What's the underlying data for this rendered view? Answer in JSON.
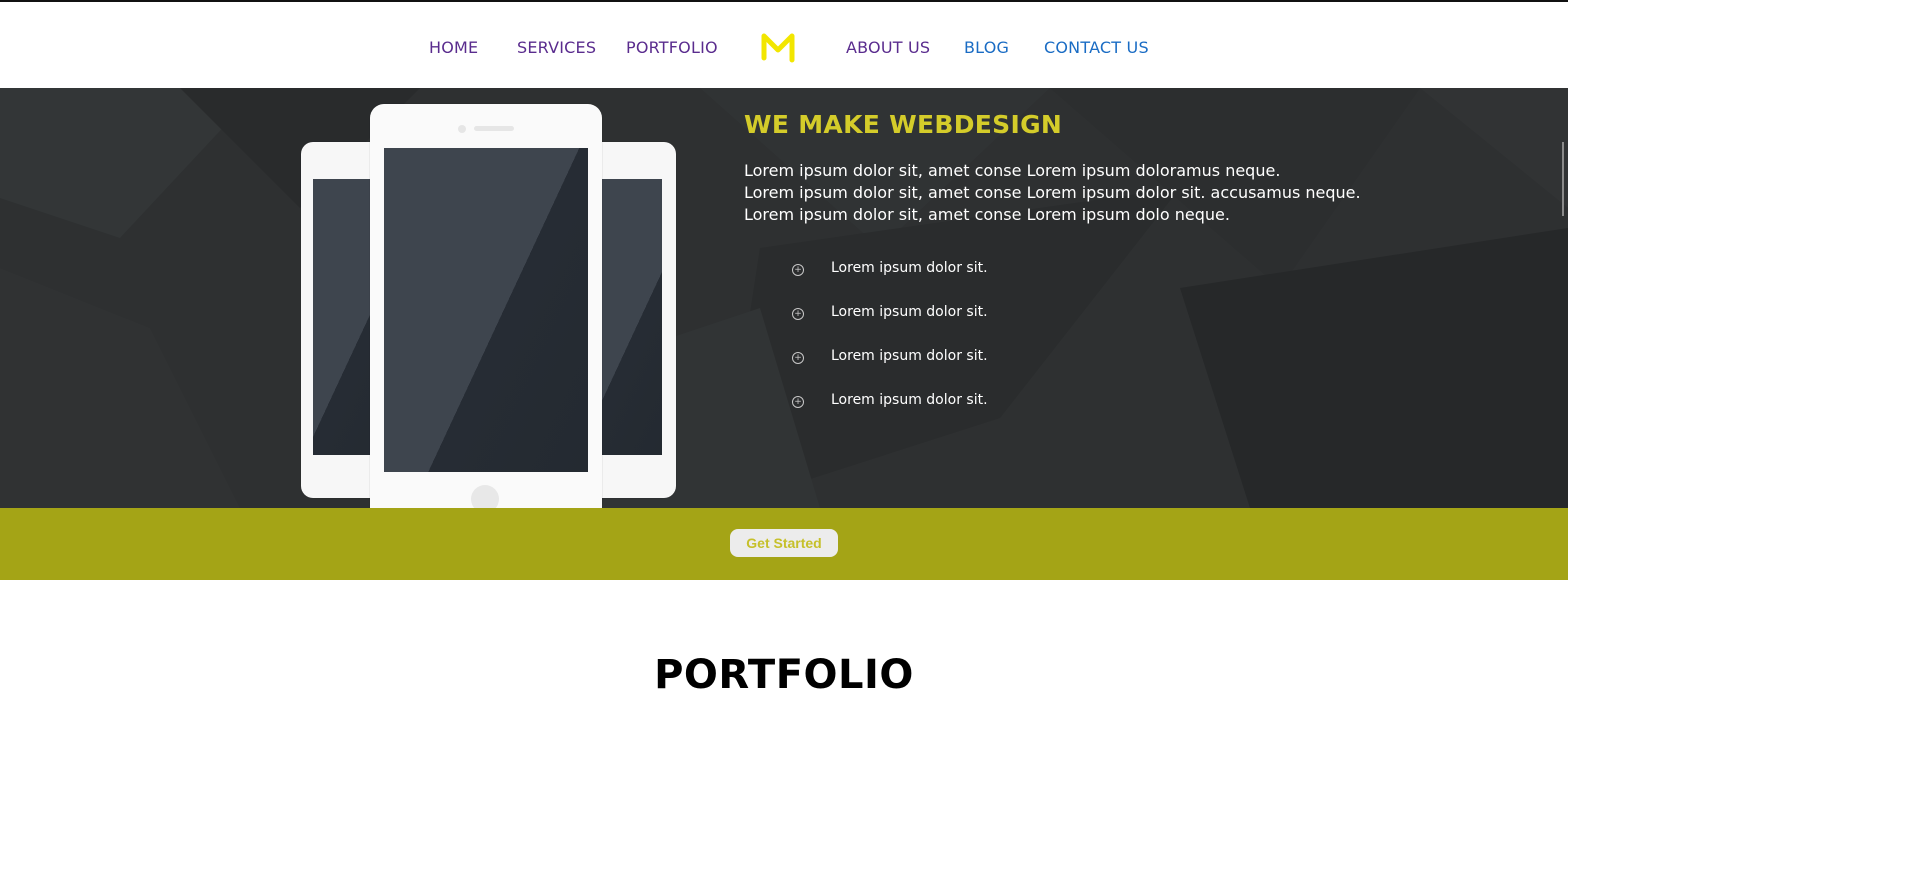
{
  "nav": {
    "items": [
      {
        "label": "HOME",
        "state": "visited"
      },
      {
        "label": "SERVICES",
        "state": "visited"
      },
      {
        "label": "PORTFOLIO",
        "state": "visited"
      },
      {
        "label": "ABOUT US",
        "state": "visited"
      },
      {
        "label": "BLOG",
        "state": "link"
      },
      {
        "label": "CONTACT US",
        "state": "link"
      }
    ],
    "logo_icon": "m-logo-icon",
    "logo_color": "#f2e600"
  },
  "hero": {
    "title": "WE MAKE WEBDESIGN",
    "paragraph_lines": [
      "Lorem ipsum dolor sit, amet conse Lorem ipsum doloramus neque.",
      "Lorem ipsum dolor sit, amet conse Lorem ipsum dolor sit. accusamus neque.",
      "Lorem ipsum dolor sit, amet conse Lorem ipsum dolo neque."
    ],
    "list_items": [
      "Lorem ipsum dolor sit.",
      "Lorem ipsum dolor sit.",
      "Lorem ipsum dolor sit.",
      "Lorem ipsum dolor sit."
    ],
    "bullet_icon": "circle-plus-icon",
    "title_color": "#d4cc2a"
  },
  "cta": {
    "button_label": "Get Started",
    "band_color": "#a4a416"
  },
  "portfolio": {
    "title": "PORTFOLIO"
  }
}
